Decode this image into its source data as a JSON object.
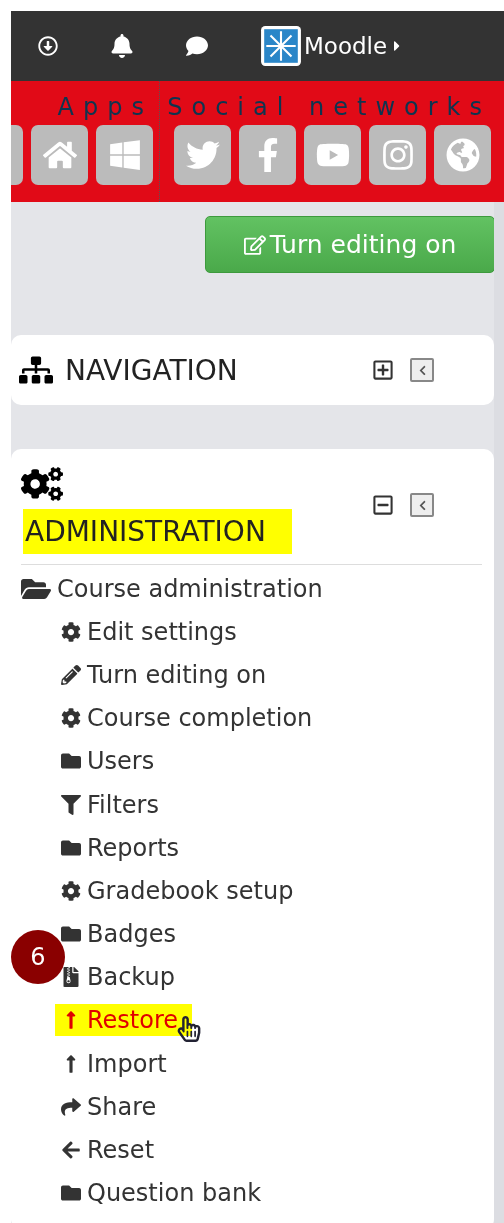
{
  "top_bar": {
    "site_name": "Moodle"
  },
  "social_bar": {
    "groups": [
      {
        "title": "Apps",
        "tiles": [
          {
            "kind": "cut"
          },
          {
            "kind": "home"
          },
          {
            "kind": "windows"
          }
        ]
      },
      {
        "title": "Social networks",
        "tiles": [
          {
            "kind": "twitter"
          },
          {
            "kind": "facebook"
          },
          {
            "kind": "youtube"
          },
          {
            "kind": "instagram"
          },
          {
            "kind": "globe"
          }
        ]
      }
    ]
  },
  "edit_button": {
    "label": "Turn editing on"
  },
  "blocks": [
    {
      "kind": "navigation",
      "title": "NAVIGATION",
      "expanded": false,
      "highlighted": false
    },
    {
      "kind": "administration",
      "title": "ADMINISTRATION",
      "expanded": true,
      "highlighted": true
    }
  ],
  "admin_tree": {
    "label": "Course administration",
    "expanded": true,
    "children": [
      {
        "label": "Edit settings",
        "kind": "gear",
        "selected": false
      },
      {
        "label": "Turn editing on",
        "kind": "pencil",
        "selected": false
      },
      {
        "label": "Course completion",
        "kind": "gear",
        "selected": false
      },
      {
        "label": "Users",
        "kind": "folder",
        "selected": false
      },
      {
        "label": "Filters",
        "kind": "filter",
        "selected": false
      },
      {
        "label": "Reports",
        "kind": "folder",
        "selected": false
      },
      {
        "label": "Gradebook setup",
        "kind": "gear",
        "selected": false
      },
      {
        "label": "Badges",
        "kind": "folder",
        "selected": false
      },
      {
        "label": "Backup",
        "kind": "archive",
        "selected": false
      },
      {
        "label": "Restore",
        "kind": "upload",
        "selected": true
      },
      {
        "label": "Import",
        "kind": "upload",
        "selected": false
      },
      {
        "label": "Share",
        "kind": "share",
        "selected": false
      },
      {
        "label": "Reset",
        "kind": "back",
        "selected": false
      },
      {
        "label": "Question bank",
        "kind": "folder",
        "selected": false
      }
    ]
  },
  "step_badge": "6"
}
